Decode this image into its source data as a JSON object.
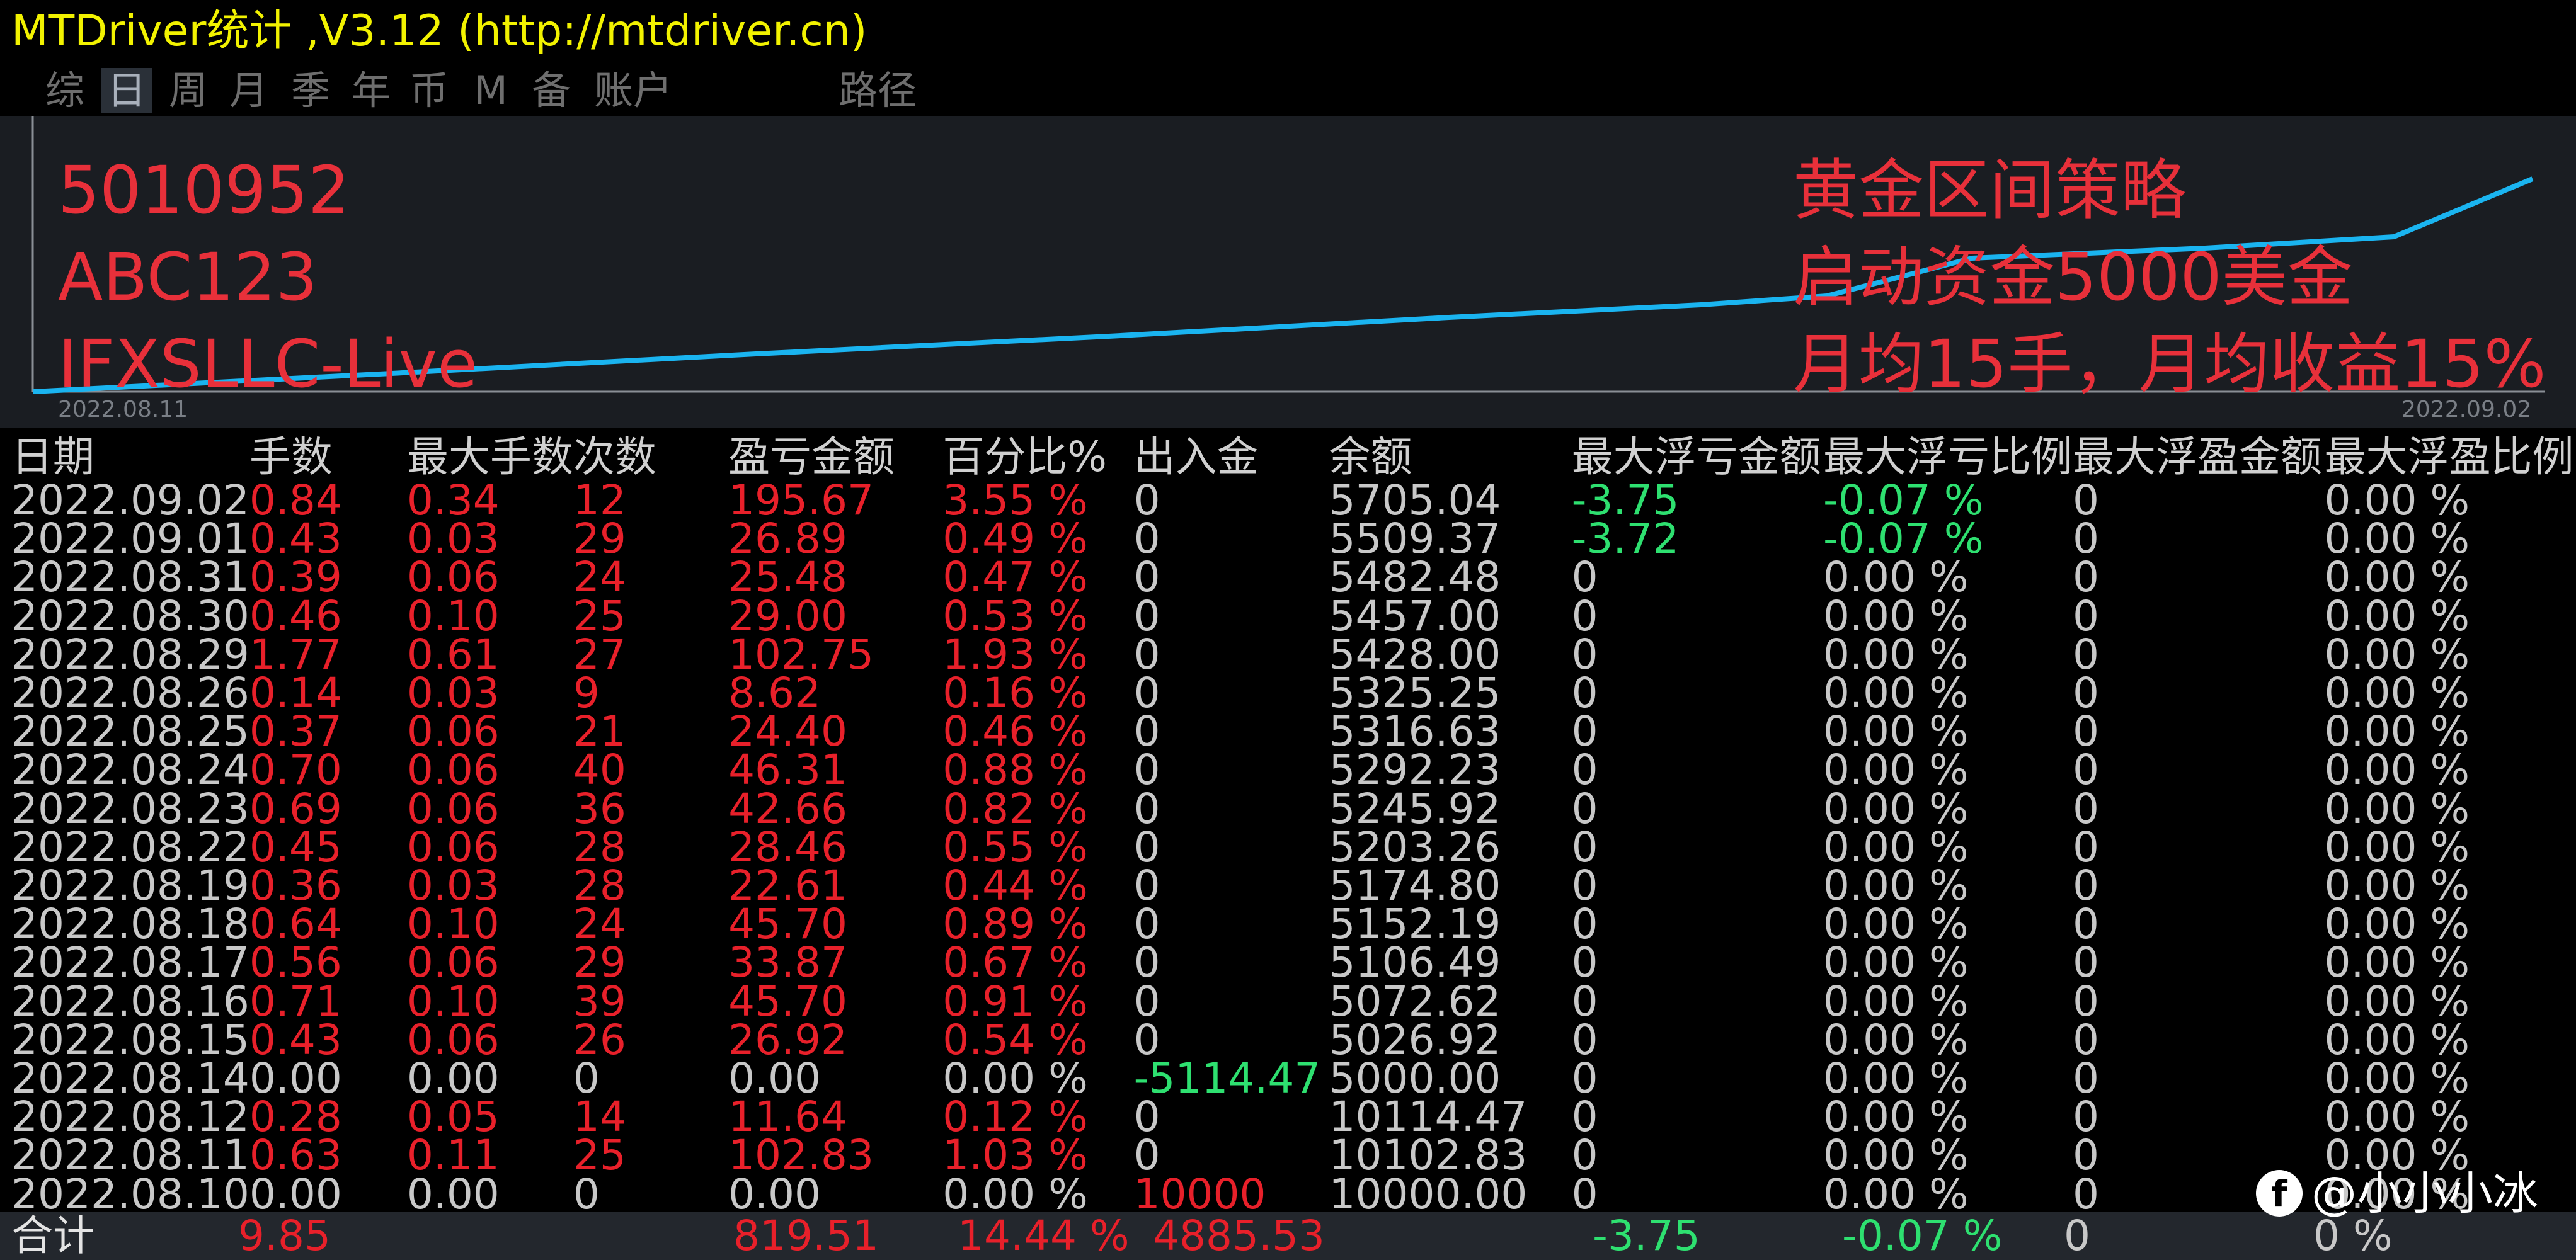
{
  "window": {
    "title": "MTDriver统计 ,V3.12 (http://mtdriver.cn)"
  },
  "tabs": [
    {
      "label": "综",
      "active": false
    },
    {
      "label": "日",
      "active": true
    },
    {
      "label": "周",
      "active": false
    },
    {
      "label": "月",
      "active": false
    },
    {
      "label": "季",
      "active": false
    },
    {
      "label": "年",
      "active": false
    },
    {
      "label": "币",
      "active": false
    },
    {
      "label": "M",
      "active": false
    },
    {
      "label": "备",
      "active": false
    },
    {
      "label": "账户",
      "active": false
    },
    {
      "label": "路径",
      "active": false
    }
  ],
  "chart": {
    "left_lines": [
      "5010952",
      "ABC123",
      "IFXSLLC-Live"
    ],
    "right_lines": [
      "黄金区间策略",
      "启动资金5000美金",
      "月均15手，月均收益15%"
    ],
    "start_date": "2022.08.11",
    "end_date": "2022.09.02",
    "line_color": "#1ab4f0",
    "text_color": "#e8303a"
  },
  "table": {
    "headers": [
      "日期",
      "手数",
      "最大手数",
      "次数",
      "盈亏金额",
      "百分比%",
      "出入金",
      "余额",
      "最大浮亏金额",
      "最大浮亏比例",
      "最大浮盈金额",
      "最大浮盈比例"
    ],
    "rows": [
      [
        "2022.09.02",
        "0.84",
        "0.34",
        "12",
        "195.67",
        "3.55 %",
        "0",
        "5705.04",
        "-3.75",
        "-0.07 %",
        "0",
        "0.00 %"
      ],
      [
        "2022.09.01",
        "0.43",
        "0.03",
        "29",
        "26.89",
        "0.49 %",
        "0",
        "5509.37",
        "-3.72",
        "-0.07 %",
        "0",
        "0.00 %"
      ],
      [
        "2022.08.31",
        "0.39",
        "0.06",
        "24",
        "25.48",
        "0.47 %",
        "0",
        "5482.48",
        "0",
        "0.00 %",
        "0",
        "0.00 %"
      ],
      [
        "2022.08.30",
        "0.46",
        "0.10",
        "25",
        "29.00",
        "0.53 %",
        "0",
        "5457.00",
        "0",
        "0.00 %",
        "0",
        "0.00 %"
      ],
      [
        "2022.08.29",
        "1.77",
        "0.61",
        "27",
        "102.75",
        "1.93 %",
        "0",
        "5428.00",
        "0",
        "0.00 %",
        "0",
        "0.00 %"
      ],
      [
        "2022.08.26",
        "0.14",
        "0.03",
        "9",
        "8.62",
        "0.16 %",
        "0",
        "5325.25",
        "0",
        "0.00 %",
        "0",
        "0.00 %"
      ],
      [
        "2022.08.25",
        "0.37",
        "0.06",
        "21",
        "24.40",
        "0.46 %",
        "0",
        "5316.63",
        "0",
        "0.00 %",
        "0",
        "0.00 %"
      ],
      [
        "2022.08.24",
        "0.70",
        "0.06",
        "40",
        "46.31",
        "0.88 %",
        "0",
        "5292.23",
        "0",
        "0.00 %",
        "0",
        "0.00 %"
      ],
      [
        "2022.08.23",
        "0.69",
        "0.06",
        "36",
        "42.66",
        "0.82 %",
        "0",
        "5245.92",
        "0",
        "0.00 %",
        "0",
        "0.00 %"
      ],
      [
        "2022.08.22",
        "0.45",
        "0.06",
        "28",
        "28.46",
        "0.55 %",
        "0",
        "5203.26",
        "0",
        "0.00 %",
        "0",
        "0.00 %"
      ],
      [
        "2022.08.19",
        "0.36",
        "0.03",
        "28",
        "22.61",
        "0.44 %",
        "0",
        "5174.80",
        "0",
        "0.00 %",
        "0",
        "0.00 %"
      ],
      [
        "2022.08.18",
        "0.64",
        "0.10",
        "24",
        "45.70",
        "0.89 %",
        "0",
        "5152.19",
        "0",
        "0.00 %",
        "0",
        "0.00 %"
      ],
      [
        "2022.08.17",
        "0.56",
        "0.06",
        "29",
        "33.87",
        "0.67 %",
        "0",
        "5106.49",
        "0",
        "0.00 %",
        "0",
        "0.00 %"
      ],
      [
        "2022.08.16",
        "0.71",
        "0.10",
        "39",
        "45.70",
        "0.91 %",
        "0",
        "5072.62",
        "0",
        "0.00 %",
        "0",
        "0.00 %"
      ],
      [
        "2022.08.15",
        "0.43",
        "0.06",
        "26",
        "26.92",
        "0.54 %",
        "0",
        "5026.92",
        "0",
        "0.00 %",
        "0",
        "0.00 %"
      ],
      [
        "2022.08.14",
        "0.00",
        "0.00",
        "0",
        "0.00",
        "0.00 %",
        "-5114.47",
        "5000.00",
        "0",
        "0.00 %",
        "0",
        "0.00 %"
      ],
      [
        "2022.08.12",
        "0.28",
        "0.05",
        "14",
        "11.64",
        "0.12 %",
        "0",
        "10114.47",
        "0",
        "0.00 %",
        "0",
        "0.00 %"
      ],
      [
        "2022.08.11",
        "0.63",
        "0.11",
        "25",
        "102.83",
        "1.03 %",
        "0",
        "10102.83",
        "0",
        "0.00 %",
        "0",
        "0.00 %"
      ],
      [
        "2022.08.10",
        "0.00",
        "0.00",
        "0",
        "0.00",
        "0.00 %",
        "10000",
        "10000.00",
        "0",
        "0.00 %",
        "0",
        "0.00 %"
      ]
    ],
    "total": {
      "label": "合计",
      "lots": "9.85",
      "pnl": "819.51",
      "pct": "14.44 %",
      "flow": "4885.53",
      "max_float_loss": "-3.75",
      "max_float_loss_pct": "-0.07 %",
      "max_float_profit": "0",
      "max_float_profit_pct": "0 %"
    }
  },
  "watermark": {
    "icon": "facebook-icon",
    "text": "@小小小冰"
  }
}
